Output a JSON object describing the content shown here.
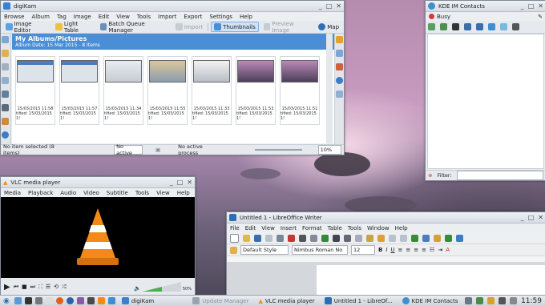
{
  "digikam": {
    "title": "digiKam",
    "menu": [
      "Browse",
      "Album",
      "Tag",
      "Image",
      "Edit",
      "View",
      "Tools",
      "Import",
      "Export",
      "Settings",
      "Help"
    ],
    "toolbar": {
      "image_editor": "Image Editor",
      "light_table": "Light Table",
      "batch_queue": "Batch Queue Manager",
      "import": "Import",
      "thumbnails": "Thumbnails",
      "preview": "Preview Image",
      "map": "Map"
    },
    "album_path": "My Albums/Pictures",
    "album_date": "Album Date: 15 Mar 2015 - 8 Items",
    "thumbs": [
      {
        "date": "15/03/2015 11:58",
        "tag": "tified: 15/03/2015 1!"
      },
      {
        "date": "15/03/2015 11:57",
        "tag": "tified: 15/03/2015 1!"
      },
      {
        "date": "15/03/2015 11:34",
        "tag": "tified: 15/03/2015 1!"
      },
      {
        "date": "15/03/2015 11:55",
        "tag": "tified: 15/03/2015 1!"
      },
      {
        "date": "15/03/2015 11:33",
        "tag": "tified: 15/03/2015 1!"
      },
      {
        "date": "15/03/2015 11:53",
        "tag": "tified: 15/03/2015 1!"
      },
      {
        "date": "15/03/2015 11:51",
        "tag": "tified: 15/03/2015 1!"
      }
    ],
    "status_selection": "No item selected (8 items)",
    "status_filter": "No active",
    "status_process": "No active process",
    "zoom": "10%"
  },
  "kde_im": {
    "title": "KDE IM Contacts",
    "status": "Busy",
    "filter_label": "Filter:"
  },
  "vlc": {
    "title": "VLC media player",
    "menu": [
      "Media",
      "Playback",
      "Audio",
      "Video",
      "Subtitle",
      "Tools",
      "View",
      "Help"
    ],
    "volume": "50%"
  },
  "writer": {
    "title": "Untitled 1 - LibreOffice Writer",
    "menu": [
      "File",
      "Edit",
      "View",
      "Insert",
      "Format",
      "Table",
      "Tools",
      "Window",
      "Help"
    ],
    "para_style": "Default Style",
    "font_name": "Nimbus Roman No",
    "font_size": "12"
  },
  "taskbar": {
    "items": [
      "digiKam",
      "Update Manager",
      "VLC media player",
      "Untitled 1 - LibreOf...",
      "KDE IM Contacts"
    ],
    "clock": "11:59"
  }
}
